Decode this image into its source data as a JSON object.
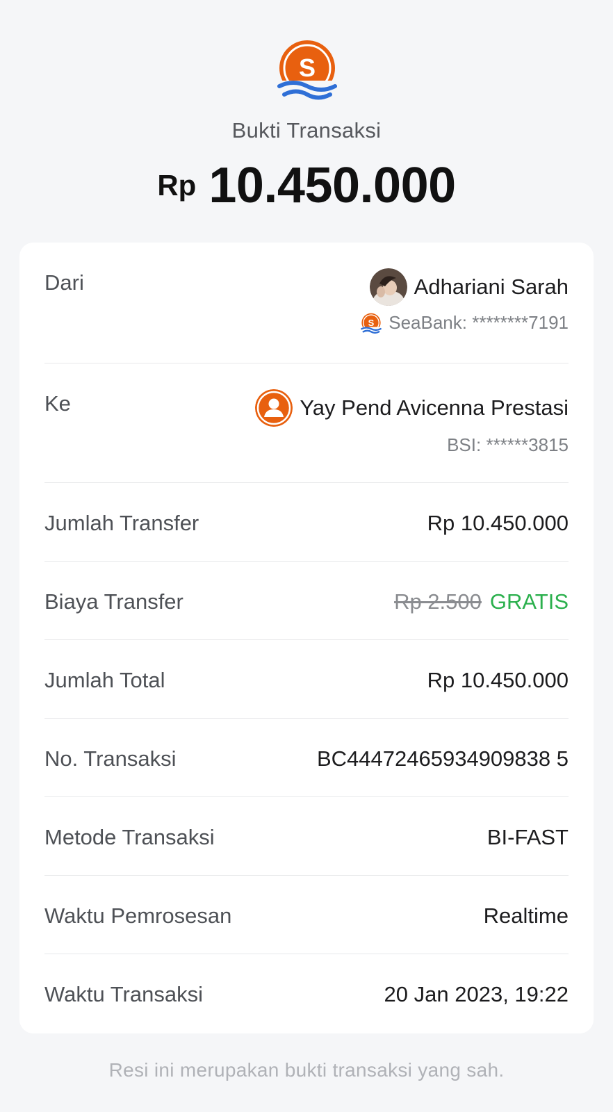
{
  "header": {
    "logo_icon": "seabank-logo-icon",
    "title": "Bukti Transaksi",
    "currency": "Rp",
    "amount": "10.450.000"
  },
  "colors": {
    "brand_orange": "#e8600f",
    "brand_blue": "#2f6fd6",
    "free_green": "#2bb04d",
    "background": "#f5f6f8"
  },
  "from": {
    "label": "Dari",
    "name": "Adhariani Sarah",
    "bank": "SeaBank: ********7191"
  },
  "to": {
    "label": "Ke",
    "name": "Yay Pend Avicenna Prestasi",
    "bank": "BSI: ******3815"
  },
  "details": {
    "transfer_amount": {
      "label": "Jumlah Transfer",
      "value": "Rp 10.450.000"
    },
    "transfer_fee": {
      "label": "Biaya Transfer",
      "original": "Rp 2.500",
      "value": "GRATIS"
    },
    "total": {
      "label": "Jumlah Total",
      "value": "Rp 10.450.000"
    },
    "transaction_no": {
      "label": "No. Transaksi",
      "value": "BC44472465934909838 5"
    },
    "method": {
      "label": "Metode Transaksi",
      "value": "BI-FAST"
    },
    "processing_time": {
      "label": "Waktu Pemrosesan",
      "value": "Realtime"
    },
    "transaction_time": {
      "label": "Waktu Transaksi",
      "value": "20 Jan 2023, 19:22"
    }
  },
  "footer": {
    "note": "Resi ini merupakan bukti transaksi yang sah."
  }
}
